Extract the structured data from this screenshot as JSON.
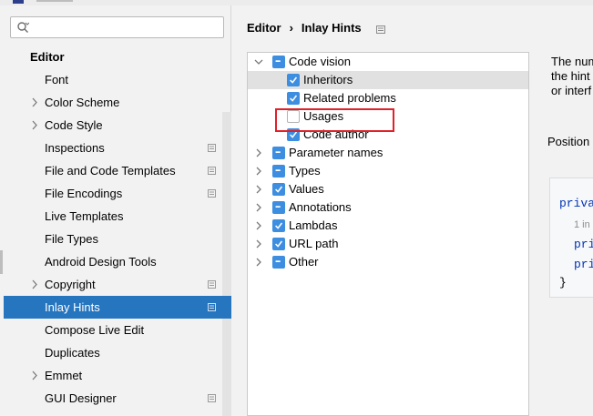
{
  "sidebar": {
    "search": {
      "value": "",
      "placeholder": ""
    },
    "items": [
      {
        "label": "Editor",
        "header": true
      },
      {
        "label": "Font"
      },
      {
        "label": "Color Scheme",
        "expandable": true
      },
      {
        "label": "Code Style",
        "expandable": true
      },
      {
        "label": "Inspections",
        "badge": true
      },
      {
        "label": "File and Code Templates",
        "badge": true
      },
      {
        "label": "File Encodings",
        "badge": true
      },
      {
        "label": "Live Templates"
      },
      {
        "label": "File Types"
      },
      {
        "label": "Android Design Tools"
      },
      {
        "label": "Copyright",
        "expandable": true,
        "badge": true
      },
      {
        "label": "Inlay Hints",
        "badge": true,
        "selected": true
      },
      {
        "label": "Compose Live Edit"
      },
      {
        "label": "Duplicates"
      },
      {
        "label": "Emmet",
        "expandable": true
      },
      {
        "label": "GUI Designer",
        "badge": true
      }
    ]
  },
  "breadcrumb": {
    "parent": "Editor",
    "separator": "›",
    "current": "Inlay Hints"
  },
  "tree": [
    {
      "label": "Code vision",
      "level": 0,
      "expanded": true,
      "check": "indeterminate"
    },
    {
      "label": "Inheritors",
      "level": 1,
      "check": "checked",
      "highlighted": true
    },
    {
      "label": "Related problems",
      "level": 1,
      "check": "checked"
    },
    {
      "label": "Usages",
      "level": 1,
      "check": "unchecked",
      "marked": true
    },
    {
      "label": "Code author",
      "level": 1,
      "check": "checked"
    },
    {
      "label": "Parameter names",
      "level": 0,
      "expanded": false,
      "check": "indeterminate"
    },
    {
      "label": "Types",
      "level": 0,
      "expanded": false,
      "check": "indeterminate"
    },
    {
      "label": "Values",
      "level": 0,
      "expanded": false,
      "check": "checked"
    },
    {
      "label": "Annotations",
      "level": 0,
      "expanded": false,
      "check": "indeterminate"
    },
    {
      "label": "Lambdas",
      "level": 0,
      "expanded": false,
      "check": "checked"
    },
    {
      "label": "URL path",
      "level": 0,
      "expanded": false,
      "check": "checked"
    },
    {
      "label": "Other",
      "level": 0,
      "expanded": false,
      "check": "indeterminate"
    }
  ],
  "description": {
    "lines": [
      "The num",
      "the hint",
      "or interf"
    ]
  },
  "position_label": "Position",
  "code_preview": {
    "line1": "priva",
    "hint": "1 in",
    "line3": "pri",
    "line4": "pri",
    "line5": "}"
  },
  "colors": {
    "selection": "#2675bf",
    "checkbox": "#3d8ee0",
    "marker": "#e0202a",
    "keyword": "#0033b3"
  }
}
